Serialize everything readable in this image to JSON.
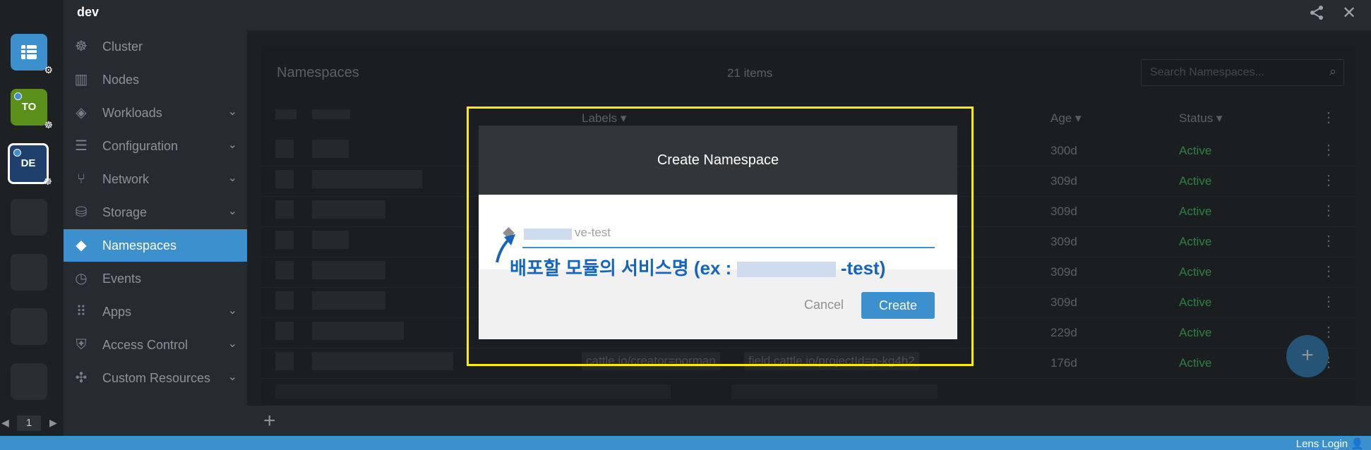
{
  "window": {
    "title": "dev"
  },
  "clusters": [
    {
      "label": "",
      "color": "#3d90ce",
      "icon": "list-icon"
    },
    {
      "label": "TO",
      "color": "#5a8f1a"
    },
    {
      "label": "DE",
      "color": "#1f3f6d"
    }
  ],
  "pager": {
    "page": "1"
  },
  "sidebar": {
    "items": [
      {
        "label": "Cluster",
        "icon": "helm-icon"
      },
      {
        "label": "Nodes",
        "icon": "nodes-icon"
      },
      {
        "label": "Workloads",
        "icon": "cubes-icon"
      },
      {
        "label": "Configuration",
        "icon": "list-icon"
      },
      {
        "label": "Network",
        "icon": "network-icon"
      },
      {
        "label": "Storage",
        "icon": "database-icon"
      },
      {
        "label": "Namespaces",
        "icon": "layers-icon"
      },
      {
        "label": "Events",
        "icon": "clock-icon"
      },
      {
        "label": "Apps",
        "icon": "apps-grid-icon"
      },
      {
        "label": "Access Control",
        "icon": "shield-icon"
      },
      {
        "label": "Custom Resources",
        "icon": "puzzle-icon"
      }
    ]
  },
  "namespaces": {
    "title": "Namespaces",
    "count": "21 items",
    "search_placeholder": "Search Namespaces...",
    "columns": {
      "labels": "Labels",
      "age": "Age",
      "status": "Status"
    },
    "rows": [
      {
        "age": "300d",
        "status": "Active"
      },
      {
        "age": "309d",
        "status": "Active"
      },
      {
        "age": "309d",
        "status": "Active"
      },
      {
        "age": "309d",
        "status": "Active"
      },
      {
        "age": "309d",
        "status": "Active"
      },
      {
        "age": "309d",
        "status": "Active"
      },
      {
        "age": "229d",
        "status": "Active"
      },
      {
        "age": "176d",
        "status": "Active"
      }
    ],
    "row8_labels": [
      "cattle.io/creator=norman",
      "field.cattle.io/projectId=p-kg4h2"
    ]
  },
  "dialog": {
    "title": "Create Namespace",
    "input_value": "ve-test",
    "cancel_label": "Cancel",
    "create_label": "Create"
  },
  "annotation": {
    "text_prefix": "배포할 모듈의 서비스명 (ex :",
    "text_suffix": "-test)"
  },
  "statusbar": {
    "login_label": "Lens Login"
  },
  "colors": {
    "accent": "#3d90ce",
    "active_status": "#48c463",
    "highlight": "#ffee00"
  }
}
